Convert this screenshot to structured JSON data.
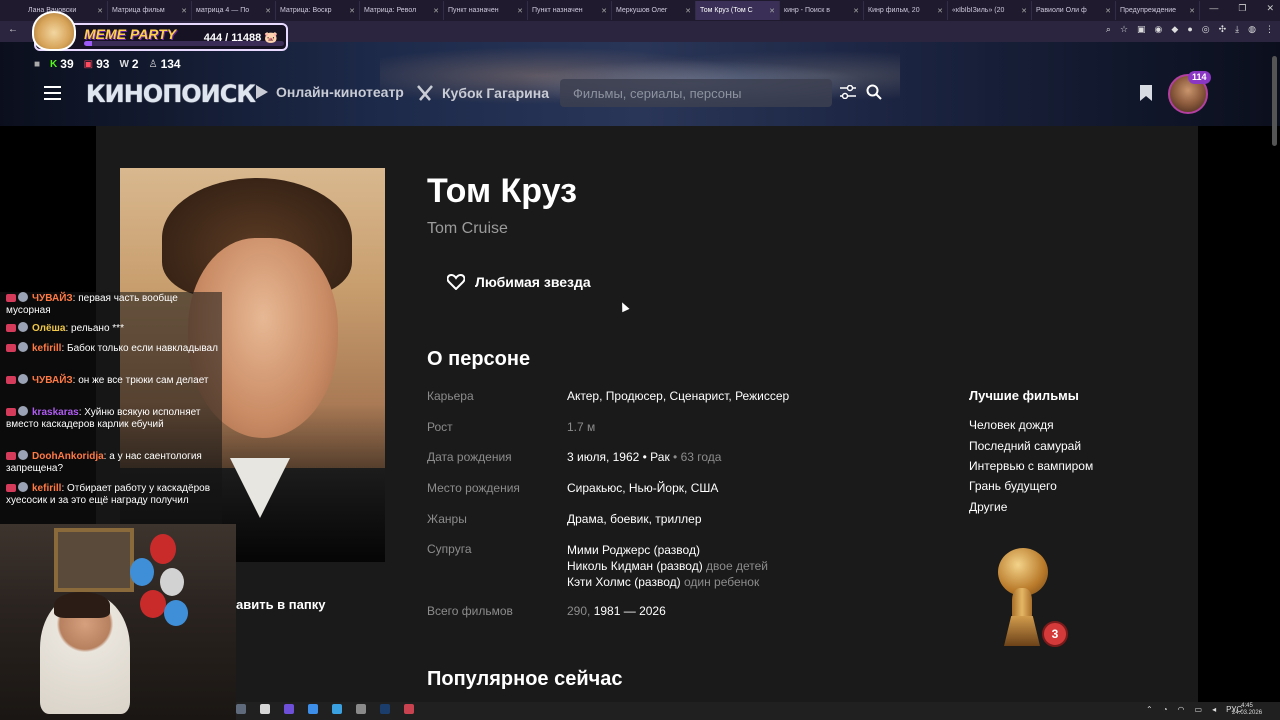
{
  "browser": {
    "tabs": [
      {
        "title": "Лана Вачовски",
        "active": false
      },
      {
        "title": "Матрица фильм",
        "active": false
      },
      {
        "title": "матрица 4 — По",
        "active": false
      },
      {
        "title": "Матрица: Воскр",
        "active": false
      },
      {
        "title": "Матрица: Револ",
        "active": false
      },
      {
        "title": "Пункт назначен",
        "active": false
      },
      {
        "title": "Пункт назначен",
        "active": false
      },
      {
        "title": "Меркушов Олег",
        "active": false
      },
      {
        "title": "Том Круз (Том С",
        "active": true
      },
      {
        "title": "кинр - Поиск в",
        "active": false
      },
      {
        "title": "Кинр фильм, 20",
        "active": false
      },
      {
        "title": "«кIbIbIЗиль» (20",
        "active": false
      },
      {
        "title": "Равиоли Оли ф",
        "active": false
      },
      {
        "title": "Предупреждение",
        "active": false
      }
    ]
  },
  "meme": {
    "title": "MEME PARTY",
    "count": "444 / 11488",
    "progress": 0.0386
  },
  "stats": [
    {
      "icon": "chat-icon",
      "value": ""
    },
    {
      "icon": "kick-icon",
      "value": "39"
    },
    {
      "icon": "vk-icon",
      "value": "93"
    },
    {
      "icon": "w-icon",
      "value": "2"
    },
    {
      "icon": "viewers-icon",
      "value": "134"
    }
  ],
  "header": {
    "logo": "КИНОПОИСК",
    "nav_online": "Онлайн-кинотеатр",
    "nav_cup": "Кубок Гагарина",
    "search_placeholder": "Фильмы, сериалы, персоны",
    "avatar_badge": "114"
  },
  "person": {
    "name": "Том Круз",
    "original": "Tom Cruise",
    "favorite": "Любимая звезда",
    "about_title": "О персоне",
    "popular_title": "Популярное сейчас",
    "folder_text": "авить в папку"
  },
  "facts": {
    "career": {
      "k": "Карьера",
      "v": "Актер, Продюсер, Сценарист, Режиссер"
    },
    "height": {
      "k": "Рост",
      "v": "1.7 м"
    },
    "birth": {
      "k": "Дата рождения",
      "v": "3 июля, 1962 • Рак",
      "extra": " • 63 года"
    },
    "birthplace": {
      "k": "Место рождения",
      "v": "Сиракьюс, Нью-Йорк, США"
    },
    "genres": {
      "k": "Жанры",
      "v": "Драма, боевик, триллер"
    },
    "spouse": {
      "k": "Супруга",
      "s1": "Мими Роджерс (развод)",
      "s2": "Николь Кидман (развод)",
      "s2x": "двое детей",
      "s3": "Кэти Холмс (развод)",
      "s3x": "один ребенок"
    },
    "total": {
      "k": "Всего фильмов",
      "count": "290,",
      "range": "1981 — 2026"
    }
  },
  "best": {
    "title": "Лучшие фильмы",
    "items": [
      "Человек дождя",
      "Последний самурай",
      "Интервью с вампиром",
      "Грань будущего",
      "Другие"
    ]
  },
  "award": {
    "count": "3"
  },
  "chat": [
    {
      "user": "ЧУВАЙЗ",
      "text": "первая часть вообще мусорная",
      "cls": "u-orange"
    },
    {
      "user": "Олёша",
      "text": "рельано ***",
      "cls": "u-yellow"
    },
    {
      "user": "kefirill",
      "text": "Бабок только если навкладывал",
      "cls": "u-orange"
    },
    {
      "user": "ЧУВАЙЗ",
      "text": "он же все трюки сам делает",
      "cls": "u-orange"
    },
    {
      "user": "kraskaras",
      "text": "Хуйню всякую исполняет вместо каскадеров карлик ебучий",
      "cls": "u-purple"
    },
    {
      "user": "DoohAnkoridja",
      "text": "а у нас саентология запрещена?",
      "cls": "u-orange"
    },
    {
      "user": "kefirill",
      "text": "Отбирает работу у каскадёров хуесосик и за это ещё награду получил",
      "cls": "u-orange"
    }
  ],
  "tray": {
    "lang": "РУС",
    "time": "4:45",
    "date": "24.03.2026"
  }
}
